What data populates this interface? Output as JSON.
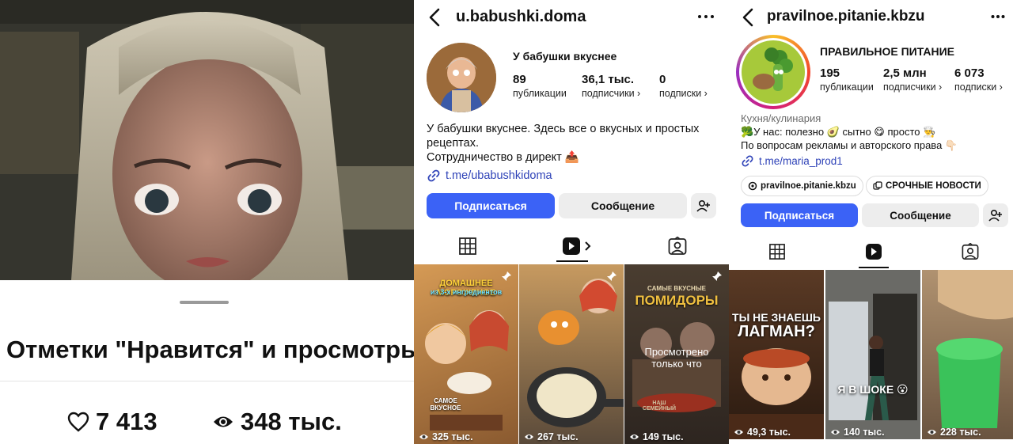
{
  "left_panel": {
    "title": "Отметки \"Нравится\" и просмотры",
    "likes": "7 413",
    "views": "348 тыс."
  },
  "profile_a": {
    "username": "u.babushki.doma",
    "name": "У бабушки вкуснее",
    "stats": [
      {
        "value": "89",
        "label": "публикации"
      },
      {
        "value": "36,1 тыс.",
        "label": "подписчики ›"
      },
      {
        "value": "0",
        "label": "подписки ›"
      }
    ],
    "bio_line1": "У бабушки вкуснее. Здесь все о вкусных и простых",
    "bio_line2": "рецептах.",
    "bio_line3": "Сотрудничество в директ 📤",
    "link": "t.me/ubabushkidoma",
    "follow_label": "Подписаться",
    "message_label": "Сообщение",
    "posts": [
      {
        "views": "325 тыс.",
        "overlay_title": "ДОМАШНЕЕ МОРОЖЕНОЕ",
        "overlay_sub": "из 3-х ингредиентов",
        "overlay_note": "САМОЕ ВКУСНОЕ"
      },
      {
        "views": "267 тыс."
      },
      {
        "views": "149 тыс.",
        "overlay_title": "ПОМИДОРЫ",
        "overlay_sub": "САМЫЕ ВКУСНЫЕ",
        "watched_line1": "Просмотрено",
        "watched_line2": "только что",
        "overlay_note": "НАШ СЕМЕЙНЫЙ"
      }
    ]
  },
  "profile_b": {
    "username": "pravilnoe.pitanie.kbzu",
    "name": "ПРАВИЛЬНОЕ ПИТАНИЕ",
    "stats": [
      {
        "value": "195",
        "label": "публикации"
      },
      {
        "value": "2,5 млн",
        "label": "подписчики ›"
      },
      {
        "value": "6 073",
        "label": "подписки ›"
      }
    ],
    "category": "Кухня/кулинария",
    "bio_line1": "🥦У нас: полезно 🥑 сытно 😋 просто 👨‍🍳",
    "bio_line2": "По вопросам рекламы и авторского права 👇🏻",
    "link": "t.me/maria_prod1",
    "chip_threads": "pravilnoe.pitanie.kbzu",
    "chip_news": "СРОЧНЫЕ НОВОСТИ",
    "follow_label": "Подписаться",
    "message_label": "Сообщение",
    "posts": [
      {
        "views": "49,3 тыс.",
        "overlay_line1": "ТЫ НЕ ЗНАЕШЬ",
        "overlay_line2": "ЛАГМАН?"
      },
      {
        "views": "140 тыс.",
        "overlay_line1": "Я В ШОКЕ 😮"
      },
      {
        "views": "228 тыс."
      }
    ]
  },
  "colors": {
    "accent_blue": "#3b62f6",
    "link_blue": "#2f43b8",
    "button_gray": "#ededed"
  }
}
